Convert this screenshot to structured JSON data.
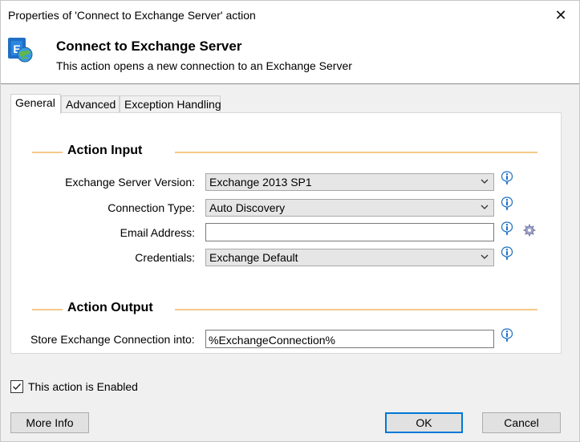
{
  "window": {
    "title": "Properties of 'Connect to Exchange Server' action",
    "close_glyph": "✕"
  },
  "header": {
    "icon": "exchange-server-icon",
    "title": "Connect to Exchange Server",
    "description": "This action opens a new connection to an Exchange Server"
  },
  "tabs": [
    {
      "label": "General",
      "active": true
    },
    {
      "label": "Advanced",
      "active": false
    },
    {
      "label": "Exception Handling",
      "active": false
    }
  ],
  "action_input": {
    "section_title": "Action Input",
    "fields": {
      "server_version": {
        "label": "Exchange Server Version:",
        "value": "Exchange 2013 SP1"
      },
      "connection_type": {
        "label": "Connection Type:",
        "value": "Auto Discovery"
      },
      "email_address": {
        "label": "Email Address:",
        "value": ""
      },
      "credentials": {
        "label": "Credentials:",
        "value": "Exchange Default"
      }
    }
  },
  "action_output": {
    "section_title": "Action Output",
    "store_label": "Store Exchange Connection into:",
    "store_value": "%ExchangeConnection%"
  },
  "enabled": {
    "label": "This action is Enabled",
    "checked": true
  },
  "buttons": {
    "more_info": "More Info",
    "ok": "OK",
    "cancel": "Cancel"
  },
  "colors": {
    "section_line": "#f5c98a",
    "info_icon": "#1c6fc2",
    "focus_border": "#0078d7"
  }
}
